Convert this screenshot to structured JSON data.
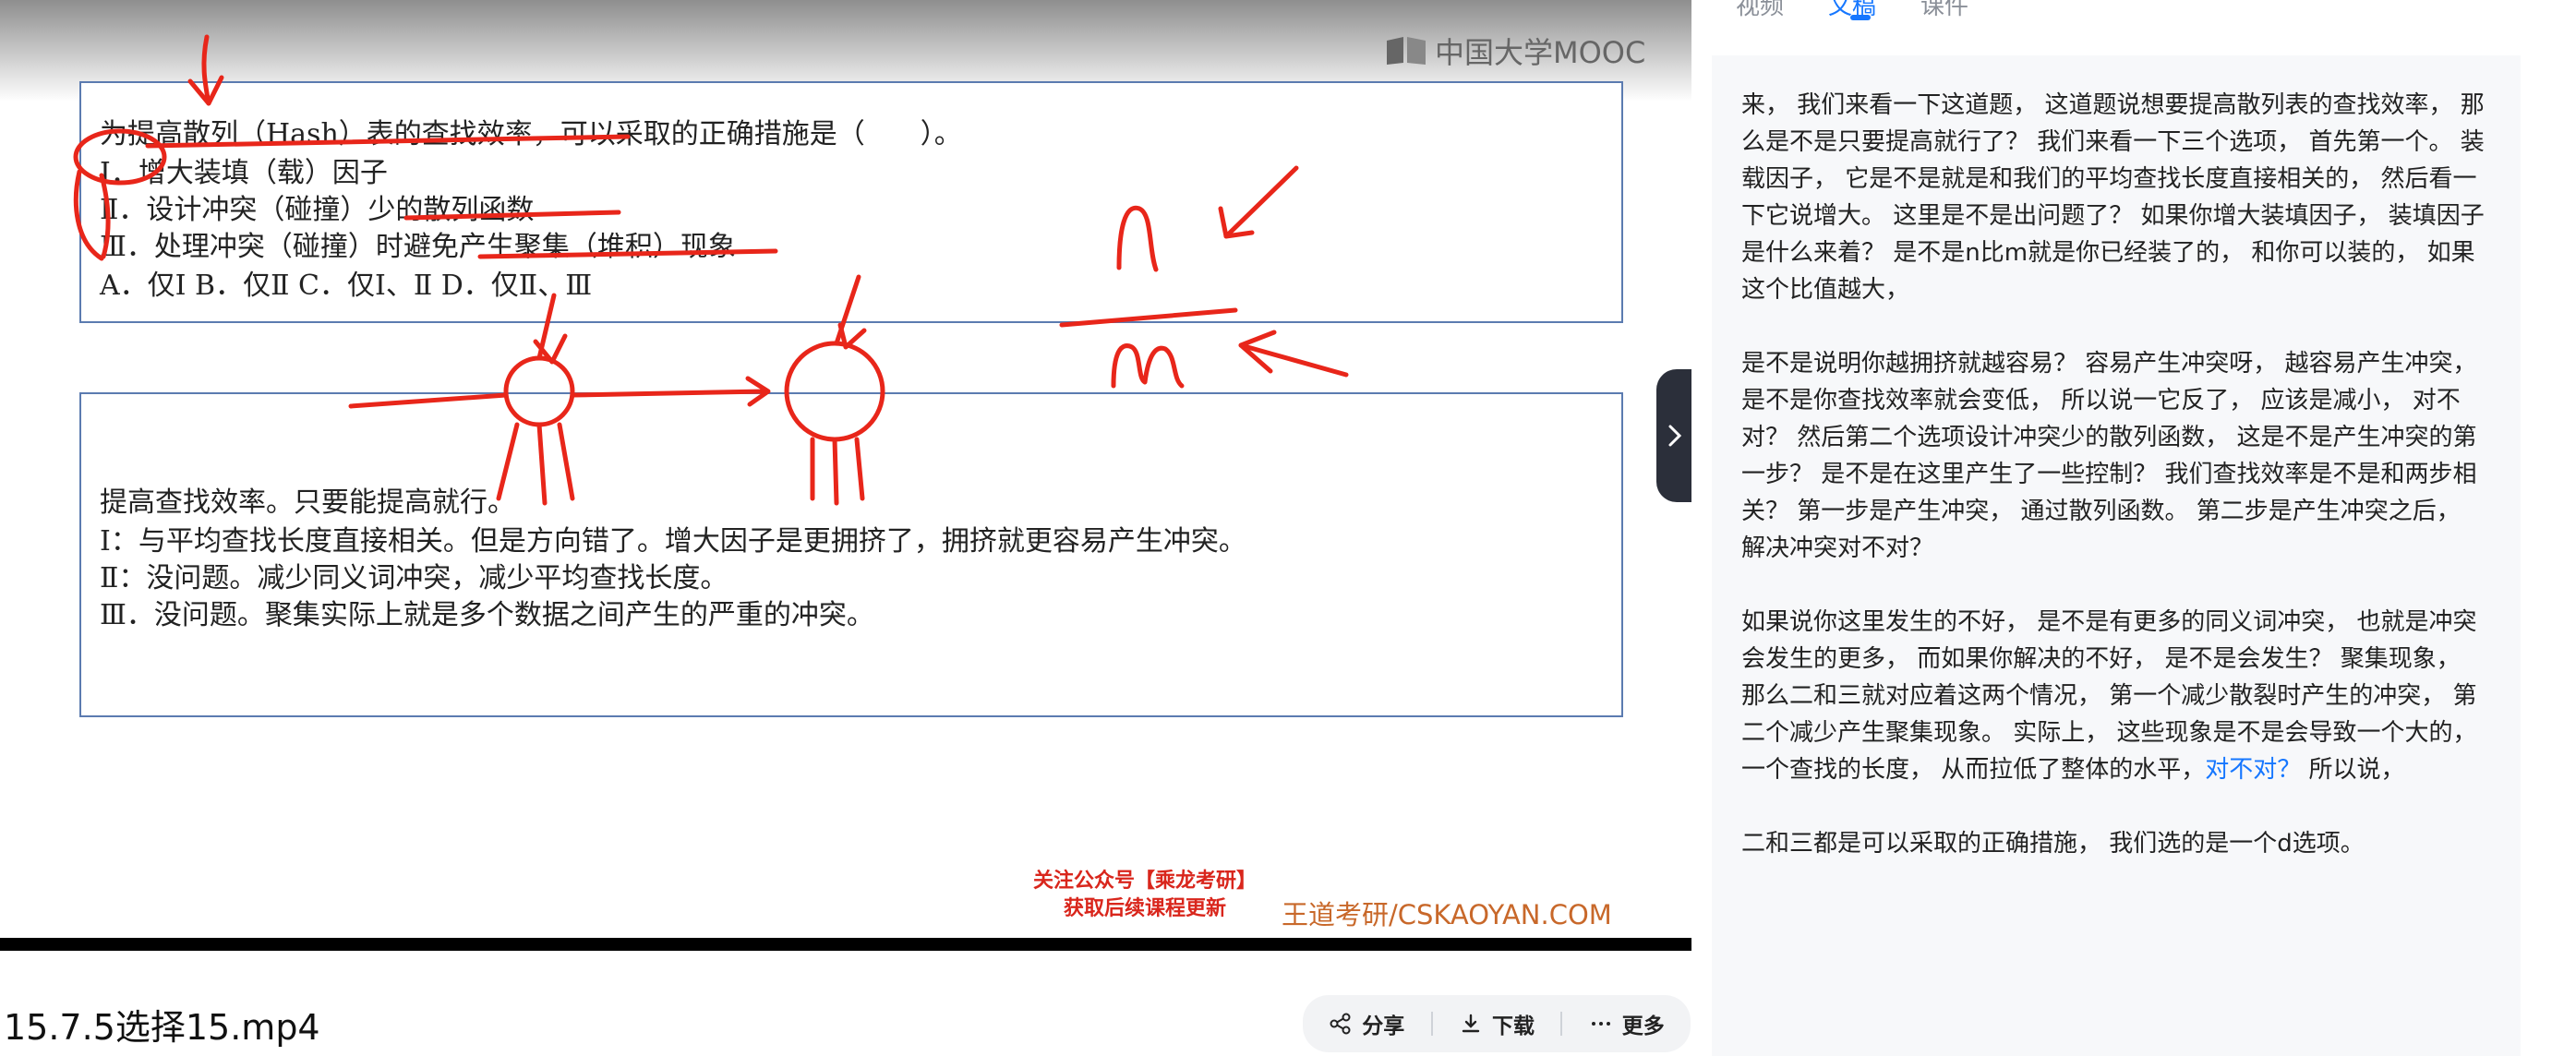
{
  "video": {
    "logo_text": "中国大学MOOC",
    "question_lines": [
      "为提高散列（Hash）表的查找效率，可以采取的正确措施是（　　）。",
      "Ⅰ．增大装填（载）因子",
      "Ⅱ．设计冲突（碰撞）少的散列函数",
      "Ⅲ．处理冲突（碰撞）时避免产生聚集（堆积）现象",
      "A．仅Ⅰ  B．仅Ⅱ  C．仅Ⅰ、Ⅱ        D．仅Ⅱ、Ⅲ"
    ],
    "answer_lines": [
      "提高查找效率。只要能提高就行。",
      "Ⅰ：与平均查找长度直接相关。但是方向错了。增大因子是更拥挤了，拥挤就更容易产生冲突。",
      "Ⅱ：没问题。减少同义词冲突，减少平均查找长度。",
      "Ⅲ．没问题。聚集实际上就是多个数据之间产生的严重的冲突。"
    ],
    "promo_line1": "关注公众号【乘龙考研】",
    "promo_line2": "获取后续课程更新",
    "watermark": "王道考研/CSKAOYAN.COM"
  },
  "file": {
    "title": "15.7.5选择15.mp4"
  },
  "actions": {
    "share": "分享",
    "download": "下载",
    "more": "更多"
  },
  "side_tabs": [
    "视频",
    "文稿",
    "课件"
  ],
  "transcript": {
    "p1": "来， 我们来看一下这道题， 这道题说想要提高散列表的查找效率， 那么是不是只要提高就行了？ 我们来看一下三个选项， 首先第一个。 装载因子， 它是不是就是和我们的平均查找长度直接相关的， 然后看一下它说增大。 这里是不是出问题了？ 如果你增大装填因子， 装填因子是什么来着？ 是不是n比m就是你已经装了的， 和你可以装的， 如果这个比值越大，",
    "p2": "是不是说明你越拥挤就越容易？ 容易产生冲突呀， 越容易产生冲突， 是不是你查找效率就会变低， 所以说一它反了， 应该是减小， 对不对？ 然后第二个选项设计冲突少的散列函数， 这是不是产生冲突的第一步？ 是不是在这里产生了一些控制？ 我们查找效率是不是和两步相关？ 第一步是产生冲突， 通过散列函数。 第二步是产生冲突之后， 解决冲突对不对？",
    "p3a": "如果说你这里发生的不好， 是不是有更多的同义词冲突， 也就是冲突会发生的更多， 而如果你解决的不好， 是不是会发生？ 聚集现象， 那么二和三就对应着这两个情况， 第一个减少散裂时产生的冲突， 第二个减少产生聚集现象。 实际上， 这些现象是不是会导致一个大的， 一个查找的长度， 从而拉低了整体的水平，",
    "p3_highlight": "对不对？",
    "p3b": " 所以说，",
    "p4": "二和三都是可以采取的正确措施， 我们选的是一个d选项。"
  },
  "colors": {
    "accent": "#1677ff",
    "ink": "#e8261a",
    "promo": "#d9261c"
  }
}
